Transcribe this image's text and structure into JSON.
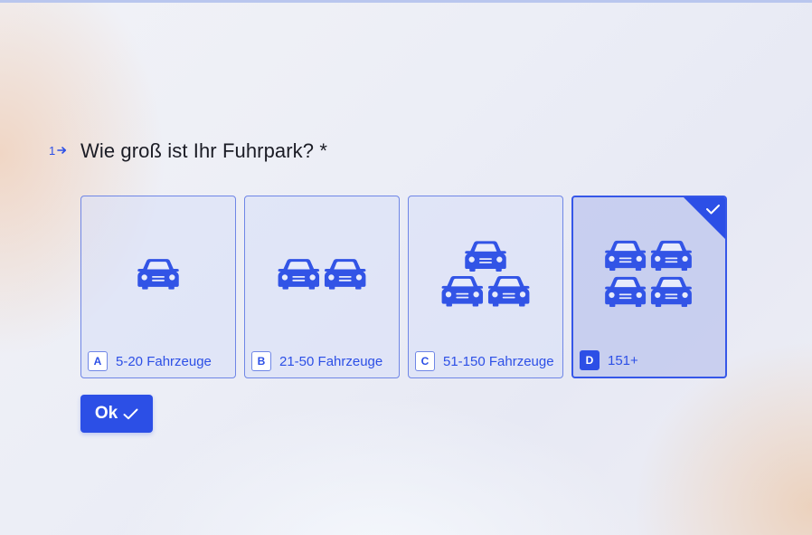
{
  "question": {
    "number": "1",
    "text": "Wie groß ist Ihr Fuhrpark? *"
  },
  "choices": [
    {
      "key": "A",
      "label": "5-20 Fahrzeuge",
      "icon": "car-icon",
      "cars": 1,
      "selected": false
    },
    {
      "key": "B",
      "label": "21-50 Fahrzeuge",
      "icon": "two-cars-icon",
      "cars": 2,
      "selected": false
    },
    {
      "key": "C",
      "label": "51-150 Fahrzeuge",
      "icon": "three-cars-icon",
      "cars": 3,
      "selected": false
    },
    {
      "key": "D",
      "label": "151+",
      "icon": "four-cars-icon",
      "cars": 4,
      "selected": true
    }
  ],
  "ok_button": {
    "label": "Ok",
    "icon": "checkmark-icon"
  },
  "colors": {
    "accent": "#2c4fe6",
    "text": "#1b1c25",
    "choice_border": "#6f86e6"
  }
}
